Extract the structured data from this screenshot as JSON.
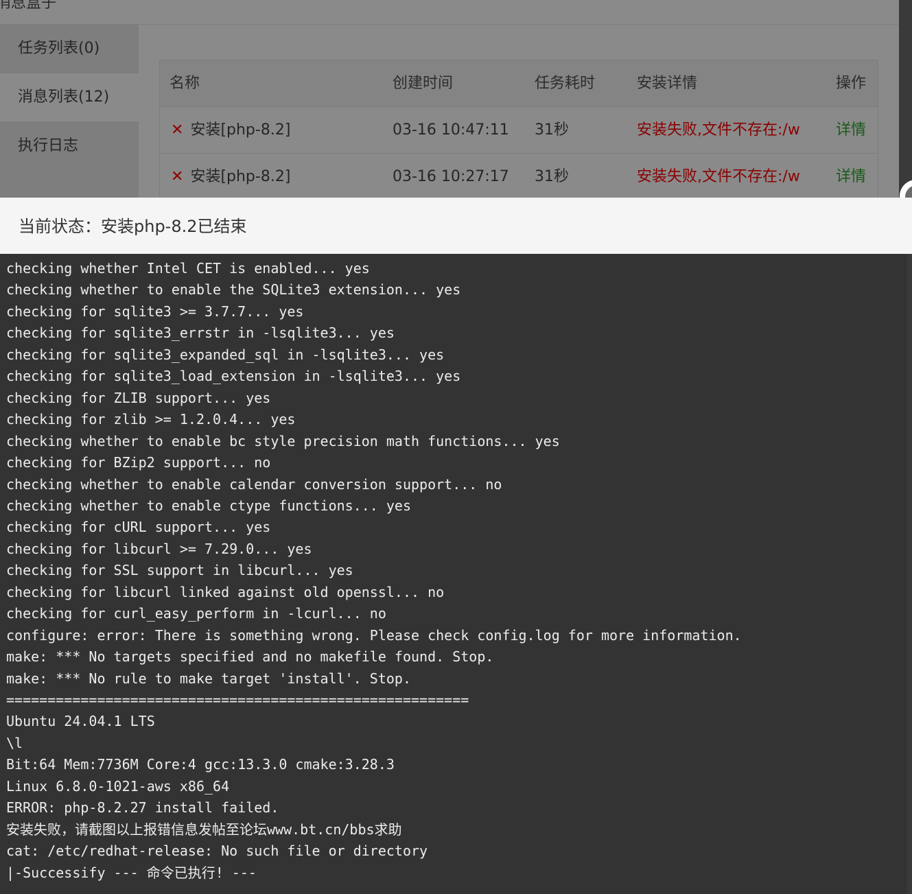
{
  "background_window": {
    "title": "消息盒子",
    "tabs": [
      {
        "label": "任务列表(0)",
        "active": false
      },
      {
        "label": "消息列表(12)",
        "active": true
      },
      {
        "label": "执行日志",
        "active": false
      }
    ],
    "table": {
      "headers": [
        "名称",
        "创建时间",
        "任务耗时",
        "安装详情",
        "操作"
      ],
      "rows": [
        {
          "name": "安装[php-8.2]",
          "created": "03-16 10:47:11",
          "duration": "31秒",
          "detail": "安装失败,文件不存在:/w",
          "action": "详情"
        },
        {
          "name": "安装[php-8.2]",
          "created": "03-16 10:27:17",
          "duration": "31秒",
          "detail": "安装失败,文件不存在:/w",
          "action": "详情"
        }
      ]
    }
  },
  "status": {
    "text": "当前状态：安装php-8.2已结束"
  },
  "console": {
    "lines": [
      "checking whether Intel CET is enabled... yes",
      "checking whether to enable the SQLite3 extension... yes",
      "checking for sqlite3 >= 3.7.7... yes",
      "checking for sqlite3_errstr in -lsqlite3... yes",
      "checking for sqlite3_expanded_sql in -lsqlite3... yes",
      "checking for sqlite3_load_extension in -lsqlite3... yes",
      "checking for ZLIB support... yes",
      "checking for zlib >= 1.2.0.4... yes",
      "checking whether to enable bc style precision math functions... yes",
      "checking for BZip2 support... no",
      "checking whether to enable calendar conversion support... no",
      "checking whether to enable ctype functions... yes",
      "checking for cURL support... yes",
      "checking for libcurl >= 7.29.0... yes",
      "checking for SSL support in libcurl... yes",
      "checking for libcurl linked against old openssl... no",
      "checking for curl_easy_perform in -lcurl... no",
      "configure: error: There is something wrong. Please check config.log for more information.",
      "make: *** No targets specified and no makefile found. Stop.",
      "make: *** No rule to make target 'install'. Stop.",
      "========================================================",
      "Ubuntu 24.04.1 LTS",
      "\\l",
      "Bit:64 Mem:7736M Core:4 gcc:13.3.0 cmake:3.28.3",
      "Linux 6.8.0-1021-aws x86_64",
      "ERROR: php-8.2.27 install failed.",
      "安装失败，请截图以上报错信息发帖至论坛www.bt.cn/bbs求助",
      "cat: /etc/redhat-release: No such file or directory",
      "|-Successify --- 命令已执行! ---"
    ]
  }
}
